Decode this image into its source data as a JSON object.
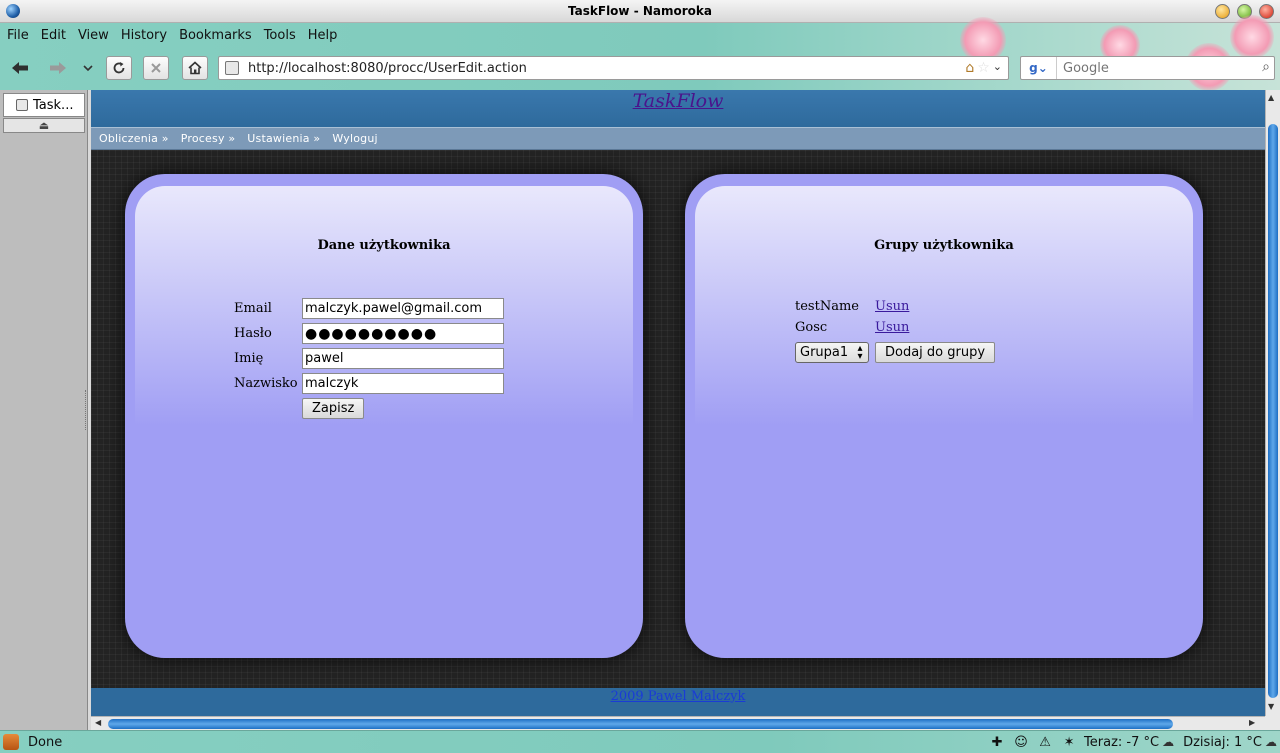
{
  "window": {
    "title": "TaskFlow - Namoroka"
  },
  "menu": [
    "File",
    "Edit",
    "View",
    "History",
    "Bookmarks",
    "Tools",
    "Help"
  ],
  "nav": {
    "url": "http://localhost:8080/procc/UserEdit.action",
    "search_placeholder": "Google",
    "back_icon": "back-arrow-icon",
    "forward_icon": "forward-arrow-icon",
    "reload_icon": "reload-icon",
    "stop_icon": "stop-icon",
    "home_icon": "home-icon"
  },
  "tabs": [
    {
      "label": "Task..."
    }
  ],
  "site": {
    "title": "TaskFlow",
    "nav_items": [
      "Obliczenia »",
      "Procesy »",
      "Ustawienia »",
      "Wyloguj"
    ],
    "footer": "2009 Pawel Malczyk"
  },
  "user_panel": {
    "heading": "Dane użytkownika",
    "fields": [
      {
        "label": "Email",
        "value": "malczyk.pawel@gmail.com"
      },
      {
        "label": "Hasło",
        "value": "●●●●●●●●●●"
      },
      {
        "label": "Imię",
        "value": "pawel"
      },
      {
        "label": "Nazwisko",
        "value": "malczyk"
      }
    ],
    "save_label": "Zapisz"
  },
  "groups_panel": {
    "heading": "Grupy użytkownika",
    "groups": [
      {
        "name": "testName",
        "action": "Usun"
      },
      {
        "name": "Gosc",
        "action": "Usun"
      }
    ],
    "select_value": "Grupa1",
    "add_label": "Dodaj do grupy"
  },
  "status": {
    "text": "Done",
    "weather_now": "Teraz: -7 °C",
    "weather_today": "Dzisiaj: 1 °C"
  },
  "colors": {
    "header_blue": "#2e6a9c",
    "panel_violet": "#a09ef4",
    "link_purple": "#4a148c"
  }
}
